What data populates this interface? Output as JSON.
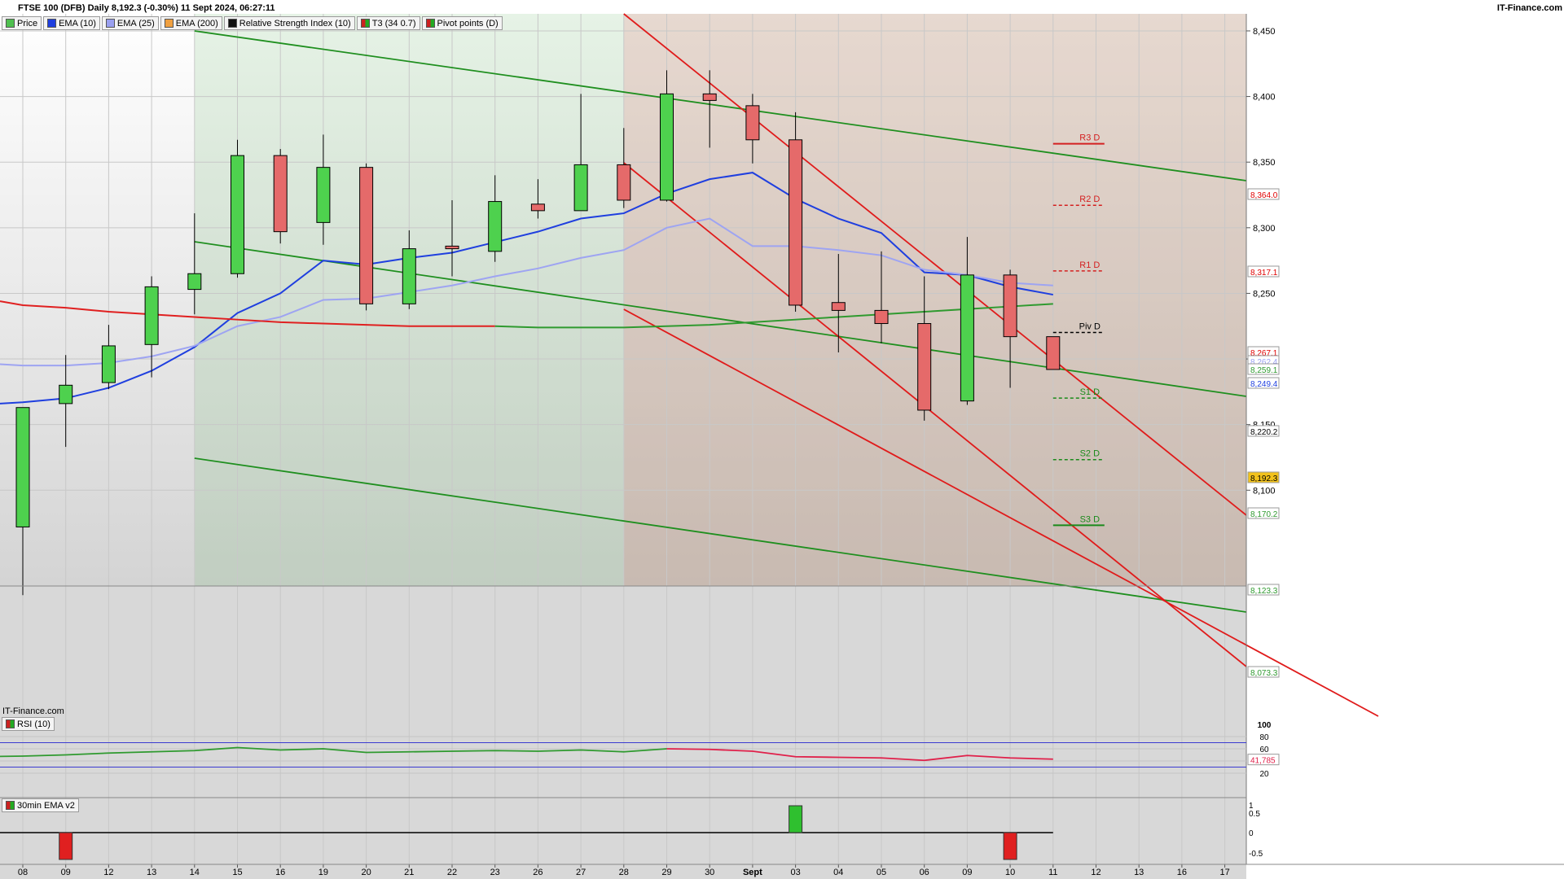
{
  "header": {
    "title": "FTSE 100 (DFB) Daily 8,192.3 (-0.30%) 11 Sept 2024, 06:27:11",
    "brand": "IT-Finance.com"
  },
  "legend": [
    {
      "label": "Price",
      "color": "#4fc04f"
    },
    {
      "label": "EMA (10)",
      "color": "#1f3fdf"
    },
    {
      "label": "EMA (25)",
      "color": "#9aa0f0"
    },
    {
      "label": "EMA (200)",
      "color": "#f0a040"
    },
    {
      "label": "Relative Strength Index (10)",
      "color": "#111111"
    },
    {
      "label": "T3 (34 0.7)",
      "color": "#cc2222"
    },
    {
      "label": "Pivot points (D)",
      "color": "#111111"
    }
  ],
  "watermark": "IT-Finance.com",
  "rsi_panel": {
    "label": "RSI (10)",
    "axis_ticks": [
      "100",
      "80",
      "60",
      "40",
      "20"
    ],
    "last_value": "41,785",
    "levels": [
      70,
      30
    ]
  },
  "ema30_panel": {
    "label": "30min EMA v2",
    "axis_ticks": [
      "1",
      "0.5",
      "0",
      "-0.5"
    ]
  },
  "colors": {
    "up": "#4ed14e",
    "down": "#e56a6a",
    "ema10": "#1f3fdf",
    "ema25": "#9ea4f2",
    "t3": "#e02020",
    "pivot_res": "#d42020",
    "pivot_sup": "#1a8a1a",
    "channel_green": "#1f8f1f",
    "channel_red": "#e01b1b"
  },
  "chart_data": {
    "type": "candlestick",
    "title": "FTSE 100 (DFB) Daily 8,192.3 (-0.30%) 11 Sept 2024, 06:27:11",
    "x_tick_labels": [
      "08",
      "09",
      "12",
      "13",
      "14",
      "15",
      "16",
      "19",
      "20",
      "21",
      "22",
      "23",
      "26",
      "27",
      "28",
      "29",
      "30",
      "Sept",
      "03",
      "04",
      "05",
      "06",
      "09",
      "10",
      "11",
      "12",
      "13",
      "16",
      "17"
    ],
    "y_ticks": [
      8100,
      8150,
      8200,
      8250,
      8300,
      8350,
      8400,
      8450
    ],
    "y_tick_labels": [
      "8,100",
      "8,150",
      "8,200",
      "8,250",
      "8,300",
      "8,350",
      "8,400",
      "8,450"
    ],
    "ylim": [
      8027,
      8463
    ],
    "candles": [
      {
        "x": "08",
        "open": 8072,
        "high": 8117,
        "low": 8020,
        "close": 8163
      },
      {
        "x": "09",
        "open": 8166,
        "high": 8203,
        "low": 8133,
        "close": 8180
      },
      {
        "x": "12",
        "open": 8182,
        "high": 8226,
        "low": 8177,
        "close": 8210
      },
      {
        "x": "13",
        "open": 8211,
        "high": 8263,
        "low": 8186,
        "close": 8255
      },
      {
        "x": "14",
        "open": 8253,
        "high": 8311,
        "low": 8234,
        "close": 8265
      },
      {
        "x": "15",
        "open": 8265,
        "high": 8367,
        "low": 8262,
        "close": 8355
      },
      {
        "x": "16",
        "open": 8355,
        "high": 8360,
        "low": 8288,
        "close": 8297
      },
      {
        "x": "19",
        "open": 8304,
        "high": 8371,
        "low": 8287,
        "close": 8346
      },
      {
        "x": "20",
        "open": 8346,
        "high": 8349,
        "low": 8237,
        "close": 8242
      },
      {
        "x": "21",
        "open": 8242,
        "high": 8298,
        "low": 8238,
        "close": 8284
      },
      {
        "x": "22",
        "open": 8286,
        "high": 8321,
        "low": 8263,
        "close": 8284
      },
      {
        "x": "23",
        "open": 8282,
        "high": 8340,
        "low": 8274,
        "close": 8320
      },
      {
        "x": "26",
        "open": 8318,
        "high": 8337,
        "low": 8307,
        "close": 8313
      },
      {
        "x": "27",
        "open": 8313,
        "high": 8402,
        "low": 8313,
        "close": 8348
      },
      {
        "x": "28",
        "open": 8348,
        "high": 8376,
        "low": 8315,
        "close": 8321
      },
      {
        "x": "29",
        "open": 8321,
        "high": 8420,
        "low": 8320,
        "close": 8402
      },
      {
        "x": "30",
        "open": 8402,
        "high": 8420,
        "low": 8361,
        "close": 8397
      },
      {
        "x": "Sept",
        "open": 8393,
        "high": 8402,
        "low": 8349,
        "close": 8367
      },
      {
        "x": "03",
        "open": 8367,
        "high": 8388,
        "low": 8236,
        "close": 8241
      },
      {
        "x": "04",
        "open": 8243,
        "high": 8280,
        "low": 8205,
        "close": 8237
      },
      {
        "x": "05",
        "open": 8237,
        "high": 8282,
        "low": 8212,
        "close": 8227
      },
      {
        "x": "06",
        "open": 8227,
        "high": 8263,
        "low": 8153,
        "close": 8161
      },
      {
        "x": "09",
        "open": 8168,
        "high": 8293,
        "low": 8165,
        "close": 8264
      },
      {
        "x": "10",
        "open": 8264,
        "high": 8268,
        "low": 8178,
        "close": 8217
      },
      {
        "x": "11",
        "open": 8217,
        "high": 8217,
        "low": 8192,
        "close": 8192
      }
    ],
    "series": [
      {
        "name": "EMA (10)",
        "values": [
          8167,
          8170,
          8178,
          8191,
          8209,
          8235,
          8250,
          8275,
          8272,
          8277,
          8281,
          8289,
          8297,
          8307,
          8311,
          8326,
          8337,
          8342,
          8322,
          8307,
          8296,
          8266,
          8264,
          8255,
          8249
        ]
      },
      {
        "name": "EMA (25)",
        "values": [
          8195,
          8195,
          8197,
          8202,
          8210,
          8225,
          8232,
          8245,
          8246,
          8251,
          8256,
          8263,
          8269,
          8277,
          8283,
          8300,
          8307,
          8286,
          8286,
          8283,
          8279,
          8268,
          8264,
          8258,
          8256
        ]
      },
      {
        "name": "T3 (34 0.7)",
        "values": [
          8241,
          8239,
          8236,
          8234,
          8232,
          8230,
          8228,
          8227,
          8226,
          8225,
          8225,
          8225,
          8224,
          8224,
          8224,
          8225,
          8226,
          8228,
          8230,
          8232,
          8234,
          8236,
          8238,
          8240,
          8242
        ]
      }
    ],
    "last_price": "8,192.3",
    "axis_value_labels": [
      "8,364.0",
      "8,317.1",
      "8,267.1",
      "8,262.4",
      "8,259.1",
      "8,249.4",
      "8,220.2",
      "8,192.3",
      "8,170.2",
      "8,123.3",
      "8,073.3"
    ],
    "pivots": [
      {
        "label": "R3 D",
        "value": 8364.0
      },
      {
        "label": "R2 D",
        "value": 8317.1
      },
      {
        "label": "R1 D",
        "value": 8267.1
      },
      {
        "label": "Piv D",
        "value": 8220.2
      },
      {
        "label": "S1 D",
        "value": 8170.2
      },
      {
        "label": "S2 D",
        "value": 8123.3
      },
      {
        "label": "S3 D",
        "value": 8073.3
      }
    ],
    "rsi": [
      48,
      50,
      53,
      55,
      57,
      62,
      58,
      60,
      54,
      55,
      56,
      57,
      56,
      58,
      55,
      60,
      59,
      56,
      47,
      46,
      45,
      41,
      49,
      45,
      43
    ],
    "ema30": [
      {
        "x": "09",
        "value": -1
      },
      {
        "x": "03",
        "value": 1
      },
      {
        "x": "10",
        "value": -1
      }
    ]
  }
}
